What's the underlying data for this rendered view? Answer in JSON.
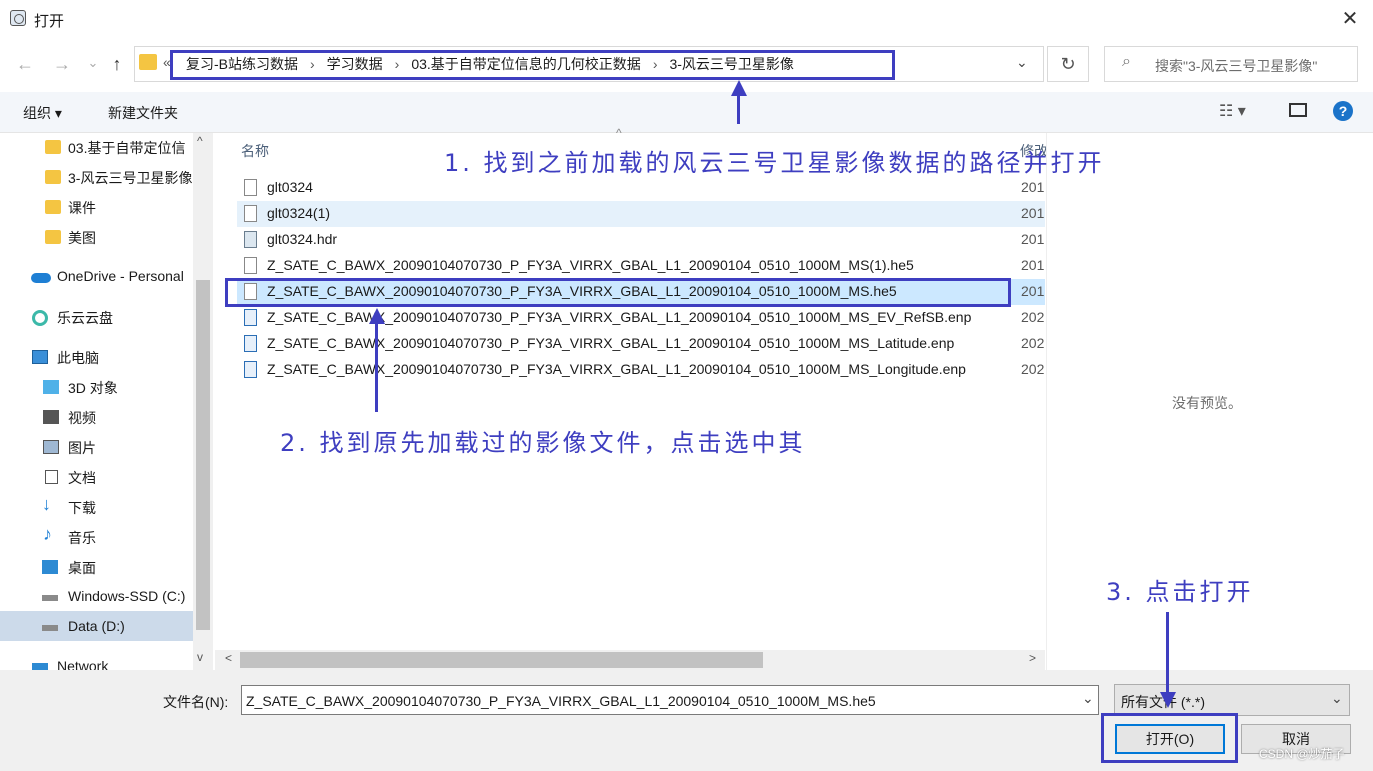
{
  "window": {
    "title": "打开",
    "close": "✕"
  },
  "nav": {
    "back": "←",
    "forward": "→",
    "recent": "⌄",
    "up": "↑"
  },
  "address": {
    "chevron": "«",
    "segments": [
      "复习-B站练习数据",
      "学习数据",
      "03.基于自带定位信息的几何校正数据",
      "3-风云三号卫星影像"
    ],
    "separator": "›",
    "dropdown": "⌄"
  },
  "refresh": "↻",
  "search": {
    "icon": "⌕",
    "placeholder": "搜索\"3-风云三号卫星影像\""
  },
  "toolbar": {
    "organize": "组织 ▾",
    "new_folder": "新建文件夹",
    "view": "☷ ▾",
    "help": "?"
  },
  "sidebar": {
    "items": [
      {
        "label": "03.基于自带定位信",
        "icon": "folder-icon"
      },
      {
        "label": "3-风云三号卫星影像",
        "icon": "folder-icon"
      },
      {
        "label": "课件",
        "icon": "folder-icon"
      },
      {
        "label": "美图",
        "icon": "folder-icon"
      },
      {
        "label": "OneDrive - Personal",
        "icon": "cloud-icon"
      },
      {
        "label": "乐云云盘",
        "icon": "le-cloud-icon"
      },
      {
        "label": "此电脑",
        "icon": "computer-icon"
      },
      {
        "label": "3D 对象",
        "icon": "3d-objects-icon"
      },
      {
        "label": "视频",
        "icon": "video-icon"
      },
      {
        "label": "图片",
        "icon": "picture-icon"
      },
      {
        "label": "文档",
        "icon": "document-icon"
      },
      {
        "label": "下载",
        "icon": "download-icon"
      },
      {
        "label": "音乐",
        "icon": "music-icon"
      },
      {
        "label": "桌面",
        "icon": "desktop-icon"
      },
      {
        "label": "Windows-SSD (C:)",
        "icon": "drive-icon"
      },
      {
        "label": "Data (D:)",
        "icon": "drive-icon"
      },
      {
        "label": "Network",
        "icon": "network-icon"
      }
    ]
  },
  "columns": {
    "name": "名称",
    "modified": "修改"
  },
  "files": [
    {
      "name": "glt0324",
      "date": "201",
      "icon": "file-icon"
    },
    {
      "name": "glt0324(1)",
      "date": "201",
      "icon": "file-icon"
    },
    {
      "name": "glt0324.hdr",
      "date": "201",
      "icon": "hdr-file-icon"
    },
    {
      "name": "Z_SATE_C_BAWX_20090104070730_P_FY3A_VIRRX_GBAL_L1_20090104_0510_1000M_MS(1).he5",
      "date": "201",
      "icon": "file-icon"
    },
    {
      "name": "Z_SATE_C_BAWX_20090104070730_P_FY3A_VIRRX_GBAL_L1_20090104_0510_1000M_MS.he5",
      "date": "201",
      "icon": "file-icon"
    },
    {
      "name": "Z_SATE_C_BAWX_20090104070730_P_FY3A_VIRRX_GBAL_L1_20090104_0510_1000M_MS_EV_RefSB.enp",
      "date": "202",
      "icon": "image-file-icon"
    },
    {
      "name": "Z_SATE_C_BAWX_20090104070730_P_FY3A_VIRRX_GBAL_L1_20090104_0510_1000M_MS_Latitude.enp",
      "date": "202",
      "icon": "image-file-icon"
    },
    {
      "name": "Z_SATE_C_BAWX_20090104070730_P_FY3A_VIRRX_GBAL_L1_20090104_0510_1000M_MS_Longitude.enp",
      "date": "202",
      "icon": "image-file-icon"
    }
  ],
  "preview": {
    "text": "没有预览。"
  },
  "scroll": {
    "left": "<",
    "right": ">",
    "up": "^",
    "down": "v"
  },
  "bottom": {
    "filename_label": "文件名(N):",
    "filename_value": "Z_SATE_C_BAWX_20090104070730_P_FY3A_VIRRX_GBAL_L1_20090104_0510_1000M_MS.he5",
    "filetype": "所有文件 (*.*)",
    "dropdown": "⌄",
    "open": "打开(O)",
    "cancel": "取消"
  },
  "annotations": {
    "step1": "1. 找到之前加载的风云三号卫星影像数据的路径并打开",
    "step2": "2. 找到原先加载过的影像文件，点击选中其",
    "step3": "3. 点击打开",
    "color": "#3e3ec0"
  },
  "watermark": "CSDN @炒茄子"
}
